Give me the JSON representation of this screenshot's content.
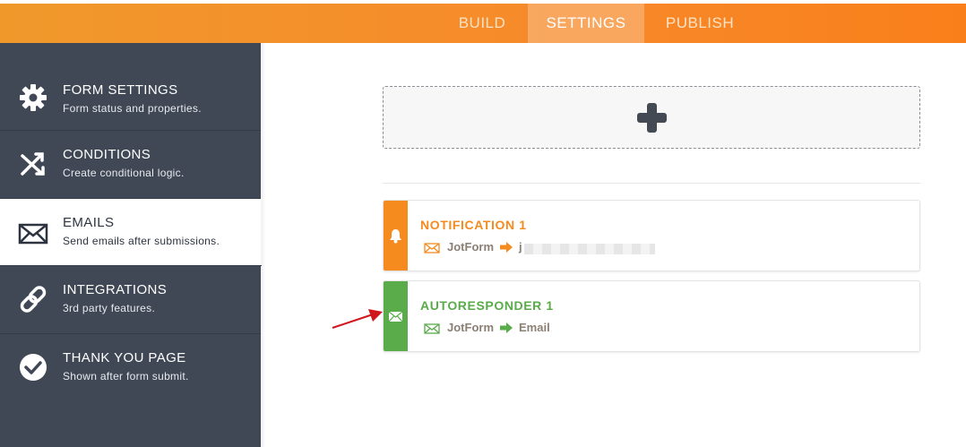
{
  "nav": {
    "tabs": [
      {
        "label": "BUILD"
      },
      {
        "label": "SETTINGS"
      },
      {
        "label": "PUBLISH"
      }
    ],
    "active_tab": "SETTINGS"
  },
  "sidebar": {
    "items": [
      {
        "title": "FORM SETTINGS",
        "subtitle": "Form status and properties.",
        "icon": "gear-icon"
      },
      {
        "title": "CONDITIONS",
        "subtitle": "Create conditional logic.",
        "icon": "conditions-icon"
      },
      {
        "title": "EMAILS",
        "subtitle": "Send emails after submissions.",
        "icon": "envelope-icon"
      },
      {
        "title": "INTEGRATIONS",
        "subtitle": "3rd party features.",
        "icon": "link-icon"
      },
      {
        "title": "THANK YOU PAGE",
        "subtitle": "Shown after form submit.",
        "icon": "check-circle-icon"
      }
    ],
    "active_item": "EMAILS"
  },
  "main": {
    "add_email_icon": "plus-icon",
    "emails": [
      {
        "title": "NOTIFICATION 1",
        "from": "JotForm",
        "to": "j",
        "type_icon": "bell-icon",
        "color": "#f58a1f",
        "to_redacted": true
      },
      {
        "title": "AUTORESPONDER 1",
        "from": "JotForm",
        "to": "Email",
        "type_icon": "envelope-icon",
        "color": "#5aab4a",
        "to_redacted": false
      }
    ]
  },
  "colors": {
    "topbar": "#f7892a",
    "sidebar": "#404855",
    "notification": "#f58a1f",
    "autoresponder": "#5aab4a",
    "annotation_arrow": "#d0161b"
  }
}
